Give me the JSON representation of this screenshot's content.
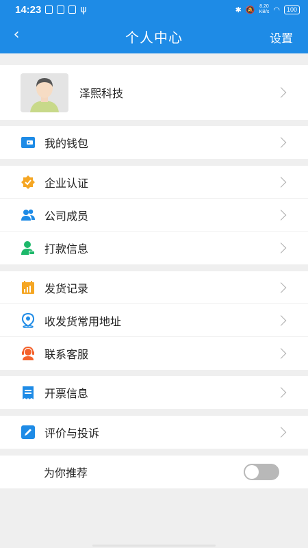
{
  "status_bar": {
    "time": "14:23",
    "battery": "100",
    "net_speed": "8.20",
    "net_unit": "KB/s"
  },
  "nav": {
    "back": "‹",
    "title": "个人中心",
    "settings": "设置"
  },
  "profile": {
    "name": "泽熙科技"
  },
  "menu": {
    "wallet": "我的钱包",
    "certification": "企业认证",
    "members": "公司成员",
    "payment_info": "打款信息",
    "shipping_records": "发货记录",
    "addresses": "收发货常用地址",
    "customer_service": "联系客服",
    "invoice_info": "开票信息",
    "reviews": "评价与投诉",
    "recommend": "为你推荐"
  },
  "recommend_toggle": false,
  "colors": {
    "primary": "#1e8be6",
    "orange": "#f5a623",
    "green": "#1db86a",
    "red_orange": "#f4622c"
  }
}
